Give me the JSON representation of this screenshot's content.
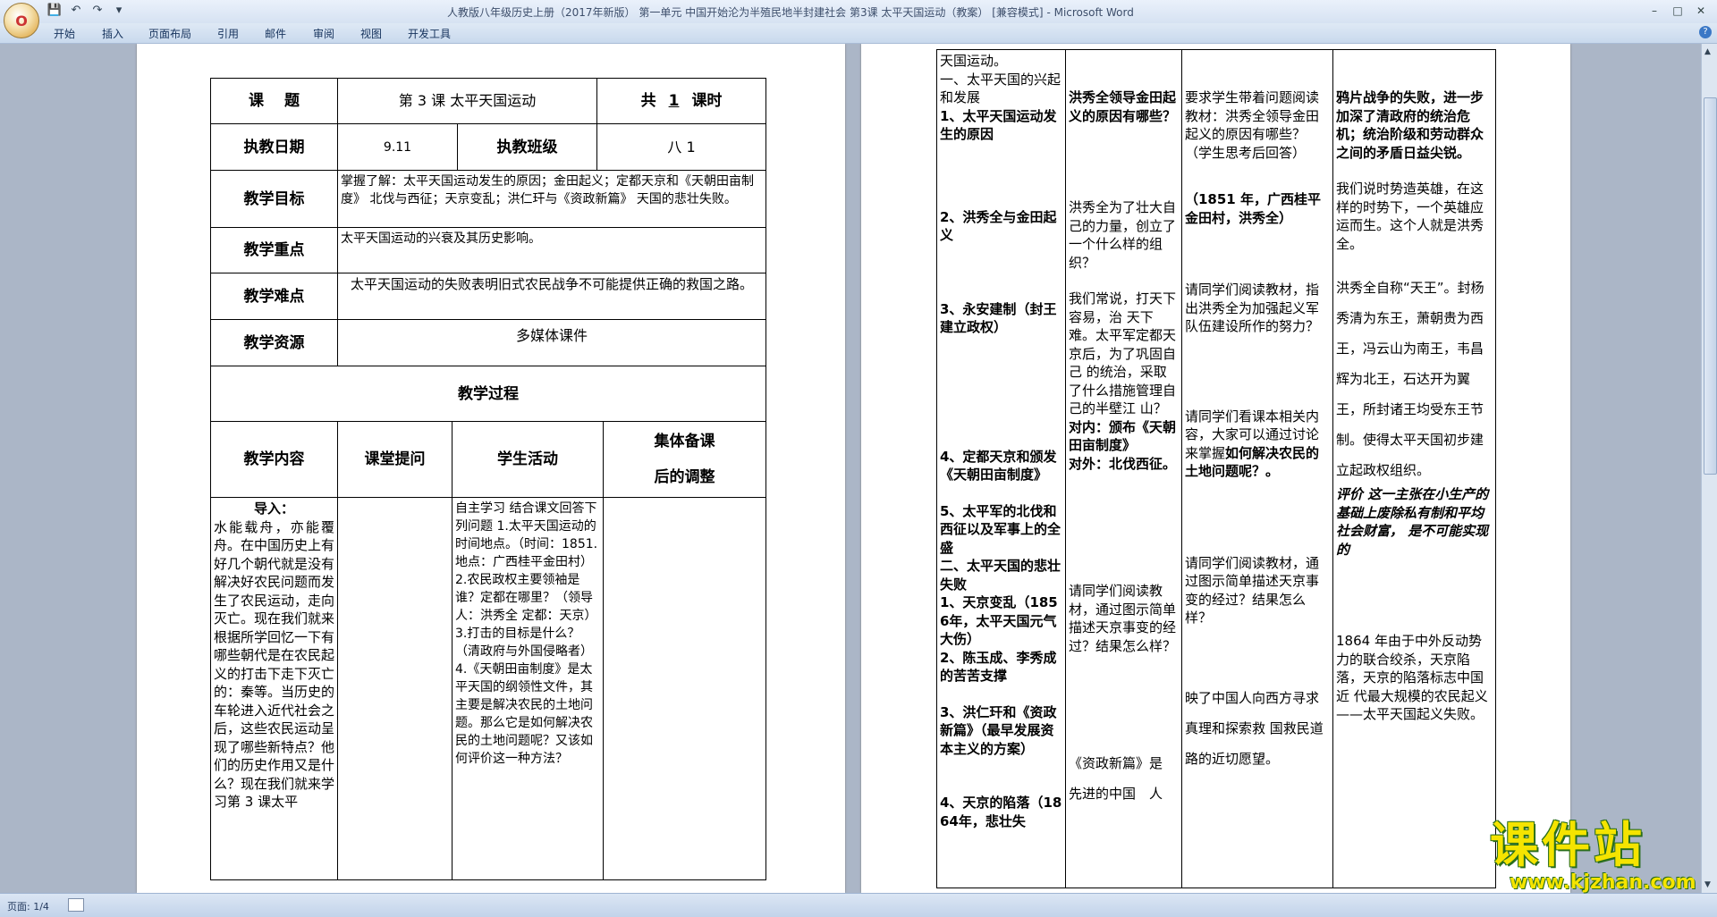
{
  "window": {
    "title": "人教版八年级历史上册（2017年新版） 第一单元 中国开始沦为半殖民地半封建社会 第3课 太平天国运动（教案） [兼容模式]",
    "app_name": "Microsoft Word",
    "office_button": "O"
  },
  "quick_access": {
    "save": "💾",
    "undo": "↶",
    "redo": "↷",
    "more": "▾"
  },
  "window_controls": {
    "minimize": "–",
    "maximize": "□",
    "close": "✕"
  },
  "menu": {
    "tabs": [
      "开始",
      "插入",
      "页面布局",
      "引用",
      "邮件",
      "审阅",
      "视图",
      "开发工具"
    ],
    "help": "?"
  },
  "page1": {
    "topic_label": "课　 题",
    "topic_value": "第 3 课  太平天国运动",
    "period_prefix": "共",
    "period_count": "1",
    "period_suffix": "课时",
    "date_label": "执教日期",
    "date_value": "9.11",
    "class_label": "执教班级",
    "class_value": "八 1",
    "goal_label": "教学目标",
    "goal_value": "掌握了解：太平天国运动发生的原因；金田起义；定都天京和《天朝田亩制度》 北伐与西征；天京变乱；洪仁玕与《资政新篇》 天国的悲壮失败。",
    "focus_label": "教学重点",
    "focus_value": "太平天国运动的兴衰及其历史影响。",
    "difficulty_label": "教学难点",
    "difficulty_value": "太平天国运动的失败表明旧式农民战争不可能提供正确的救国之路。",
    "resource_label": "教学资源",
    "resource_value": "多媒体课件",
    "process_label": "教学过程",
    "col_headers": [
      "教学内容",
      "课堂提问",
      "学生活动"
    ],
    "col4_line1": "集体备课",
    "col4_line2": "后的调整",
    "intro_title": "导入：",
    "intro_text": "水能载舟，亦能覆舟。在中国历史上有好几个朝代就是没有解决好农民问题而发生了农民运动，走向灭亡。现在我们就来根据所学回忆一下有哪些朝代是在农民起义的打击下走下灭亡的：秦等。当历史的车轮进入近代社会之后，这些农民运动呈现了哪些新特点？他们的历史作用又是什么？现在我们就来学习第 3 课太平",
    "student_activity": "自主学习 结合课文回答下列问题 1.太平天国运动的时间地点。（时间：1851.地点：广西桂平金田村） 2.农民政权主要领袖是谁？定都在哪里？（领导人：洪秀全 定都：天京） 3.打击的目标是什么？（清政府与外国侵略者） 4.《天朝田亩制度》是太平天国的纲领性文件，其主要是解决农民的土地问题。那么它是如何解决农民的土地问题呢？又该如何评价这一种方法？"
  },
  "page2": {
    "content_lines": [
      "天国运动。",
      "一、太平天国的兴起和发展",
      "1、太平天国运动发生的原因",
      "2、洪秀全与金田起义",
      "3、永安建制（封王建立政权）",
      "4、定都天京和颁发《天朝田亩制度》",
      "5、太平军的北伐和西征以及军事上的全盛",
      "二、太平天国的悲壮失败",
      "1、天京变乱（1856年，太平天国元气大伤）",
      "2、陈玉成、李秀成的苦苦支撑",
      "3、洪仁玕和《资政新篇》（最早发展资本主义的方案）",
      "4、天京的陷落（1864年，悲壮失"
    ],
    "question_1": "洪秀全领导金田起义的原因有哪些？",
    "question_2": "洪秀全为了壮大自己的力量，创立了一个什么样的组织？",
    "question_3": "我们常说，打天下容易，治 天下难。太平军定都天京后，为了巩固自己 的统治，采取了什么措施管理自己的半壁江 山？",
    "question_4a": "对内：颁布《天朝田亩制度》",
    "question_4b": "对外：北伐西征。",
    "question_5": "请同学们阅读教材，通过图示简单描述天京事变的经过？结果怎么样？",
    "question_6a": "《资政新篇》是",
    "question_6b": "先进的中国　人",
    "activity_1": "要求学生带着问题阅读教材：洪秀全领导金田起义的原因有哪些？（学生思考后回答）",
    "activity_2": "（1851 年，广西桂平金田村，洪秀全）",
    "activity_3": "请同学们阅读教材，指出洪秀全为加强起义军队伍建设所作的努力？",
    "activity_4a": "请同学们看课本相关内容，大家可以通过讨论来掌握",
    "activity_4b": "如何解决农民的土地问题呢？。",
    "activity_5": "请同学们阅读教材，通过图示简单描述天京事变的经过？结果怎么样？",
    "activity_6": "映了中国人向西方寻求真理和探索救 国救民道路的近切愿望。",
    "adjust_1": "鸦片战争的失败，进一步加深了清政府的统治危机；统治阶级和劳动群众之间的矛盾日益尖锐。",
    "adjust_2": "我们说时势造英雄，在这样的时势下，一个英雄应运而生。这个人就是洪秀全。",
    "adjust_3": "洪秀全自称“天王”。封杨秀清为东王，萧朝贵为西王，冯云山为南王，韦昌辉为北王，石达开为翼王，所封诸王均受东王节制。使得太平天国初步建立起政权组织。",
    "adjust_4": "评价 这一主张在小生产的基础上废除私有制和平均社会财富， 是不可能实现的",
    "adjust_5": "1864 年由于中外反动势力的联合绞杀，天京陷落，天京的陷落标志中国近 代最大规模的农民起义——太平天国起义失败。"
  },
  "status": {
    "page": "页面: 1/4"
  },
  "watermark": {
    "name": "课件站",
    "url": "www.kjzhan.com"
  }
}
